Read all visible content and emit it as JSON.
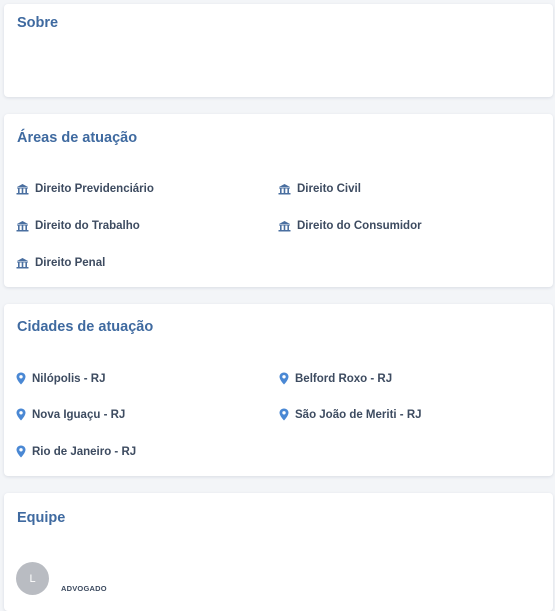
{
  "colors": {
    "accent": "#3f6aa0",
    "pin": "#4a88d4",
    "avatar_bg": "#b9bcc2"
  },
  "about": {
    "title": "Sobre"
  },
  "areas": {
    "title": "Áreas de atuação",
    "icon": "building-icon",
    "items": [
      {
        "label": "Direito Previdenciário"
      },
      {
        "label": "Direito Civil"
      },
      {
        "label": "Direito do Trabalho"
      },
      {
        "label": "Direito do Consumidor"
      },
      {
        "label": "Direito Penal"
      }
    ]
  },
  "cities": {
    "title": "Cidades de atuação",
    "icon": "map-pin-icon",
    "items": [
      {
        "label": "Nilópolis - RJ"
      },
      {
        "label": "Belford Roxo - RJ"
      },
      {
        "label": "Nova Iguaçu - RJ"
      },
      {
        "label": "São João de Meriti - RJ"
      },
      {
        "label": "Rio de Janeiro - RJ"
      }
    ]
  },
  "team": {
    "title": "Equipe",
    "members": [
      {
        "initial": "L",
        "role": "ADVOGADO"
      }
    ]
  }
}
